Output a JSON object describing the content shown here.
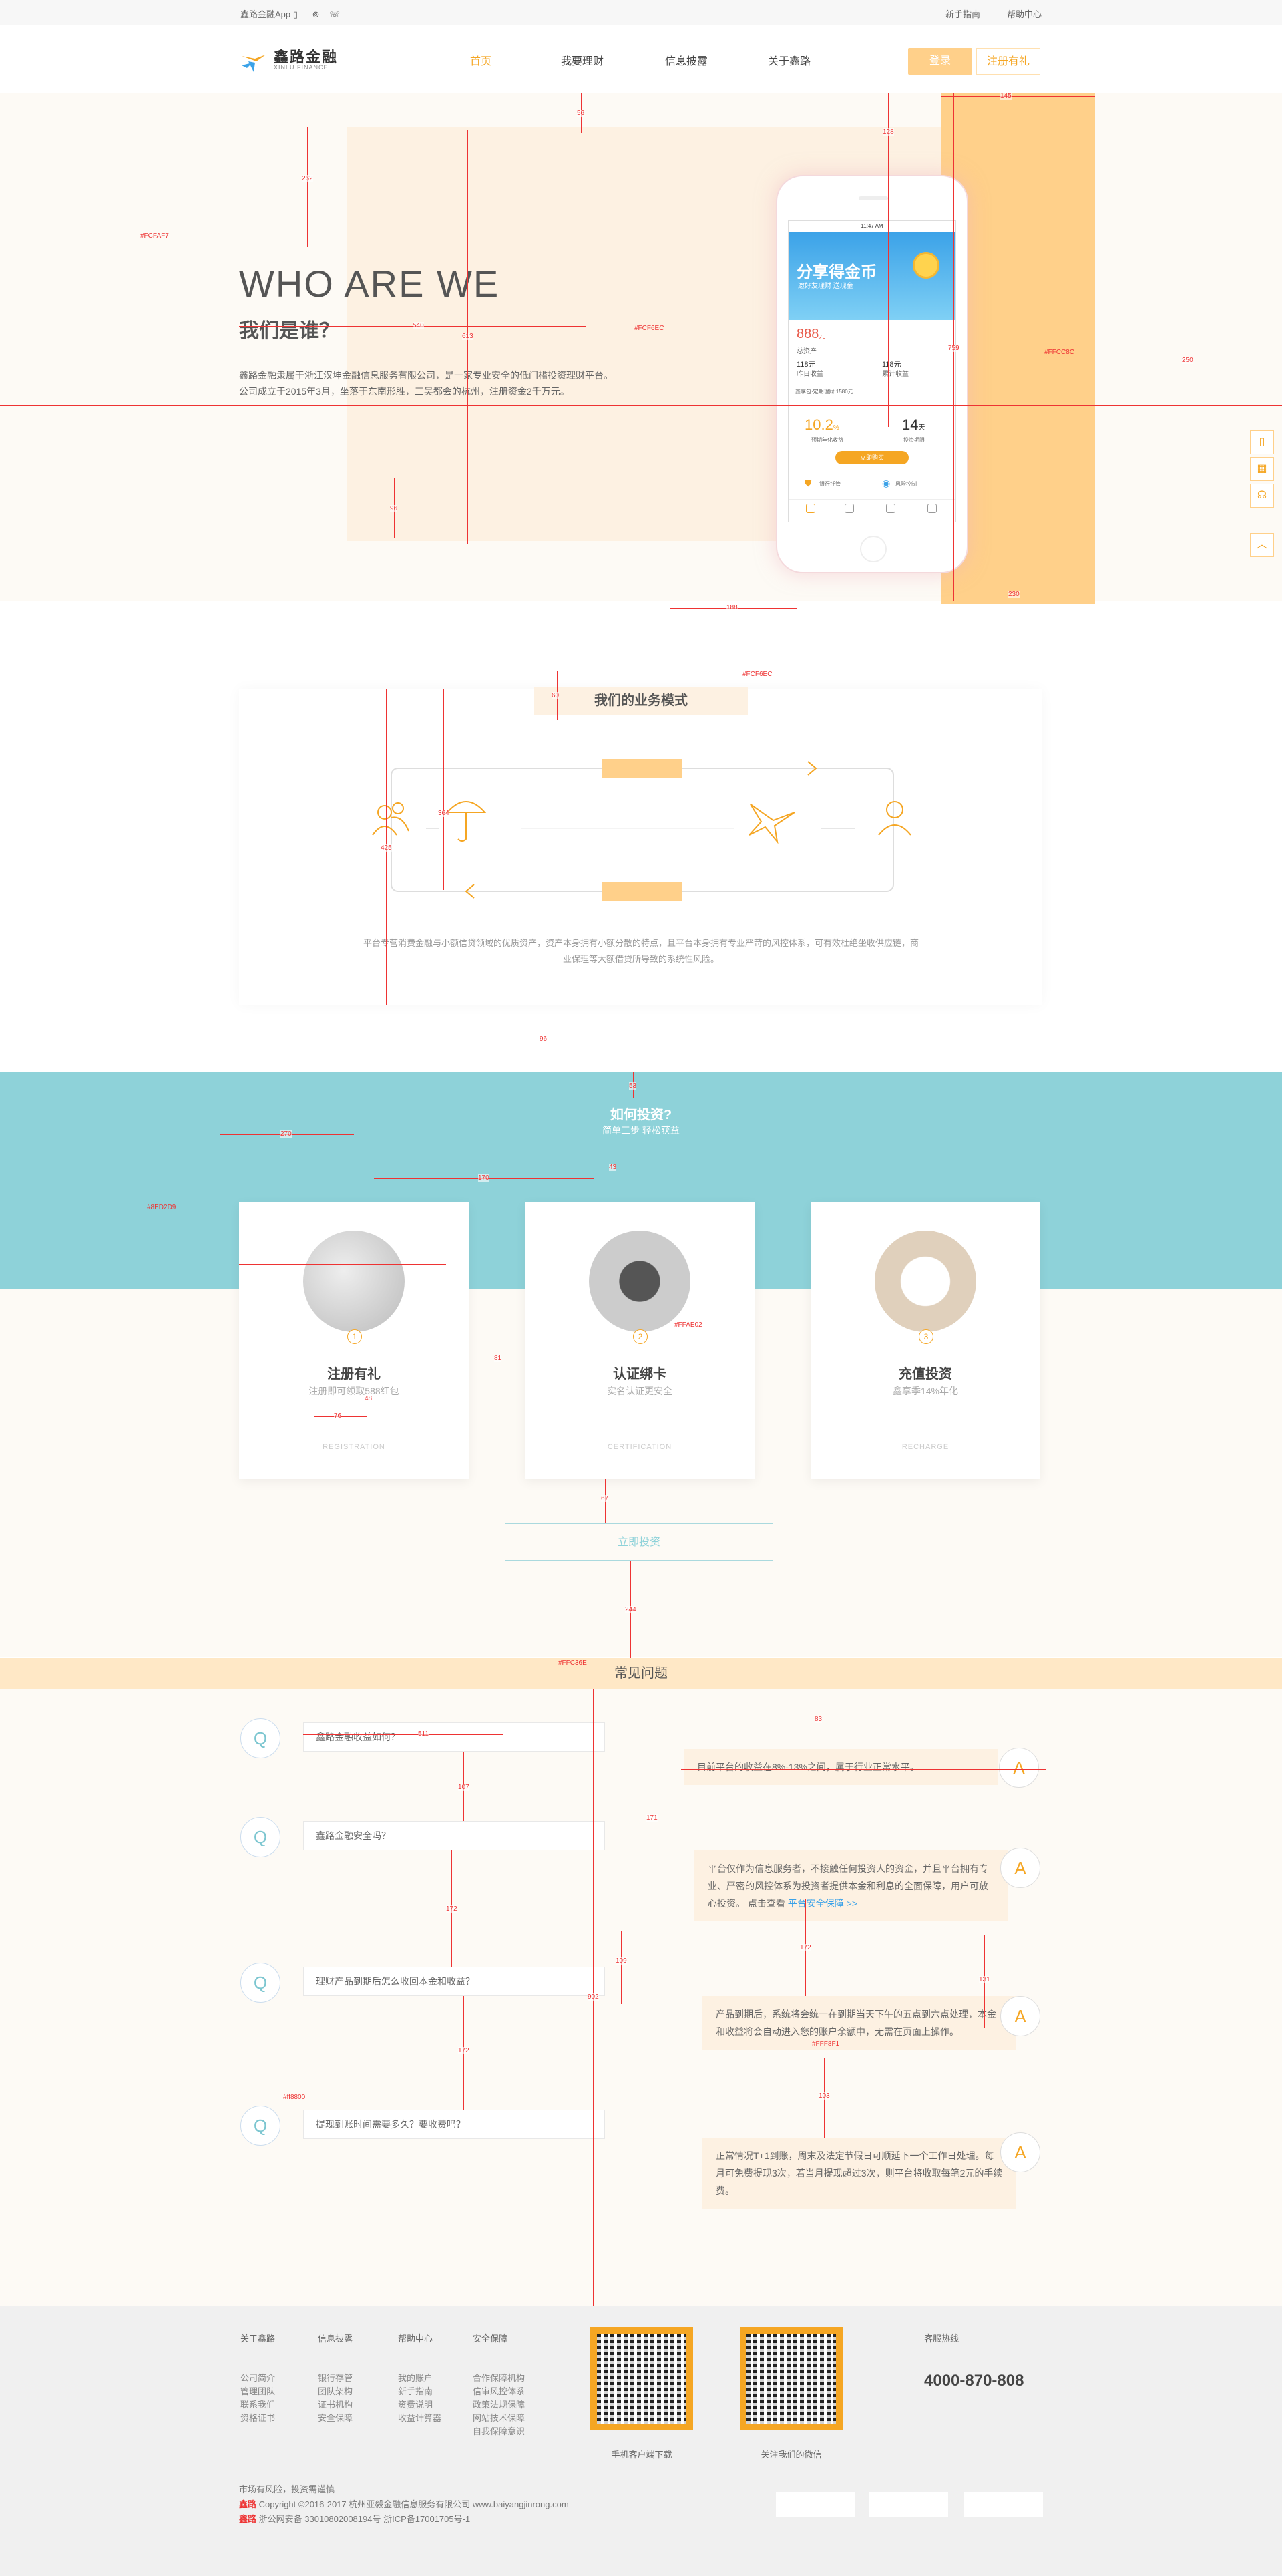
{
  "topbar": {
    "app": "鑫路金融App",
    "help1": "新手指南",
    "help2": "帮助中心"
  },
  "header": {
    "logo_cn": "鑫路金融",
    "logo_en": "XINLU FINANCE",
    "nav": [
      "首页",
      "我要理财",
      "信息披露",
      "关于鑫路"
    ],
    "login": "登录",
    "register": "注册有礼"
  },
  "hero": {
    "title_en": "WHO ARE WE",
    "title_cn": "我们是谁？",
    "desc": "鑫路金融隶属于浙江汉坤金融信息服务有限公司，是一家专业安全的低门槛投资理财平台。公司成立于2015年3月，坐落于东南形胜，三吴都会的杭州，注册资金2千万元。"
  },
  "phone": {
    "status": "11:47 AM",
    "banner_title": "分享得金币",
    "banner_sub": "邀好友理财 送现金",
    "amount": "888",
    "amount_unit": "元",
    "amount_label": "总资产",
    "s1": "118元",
    "s1l": "昨日收益",
    "s2": "118元",
    "s2l": "累计收益",
    "notice": "鑫享包·定期理财 1580元",
    "rate": "10.2",
    "rate_unit": "%",
    "rate_label": "预期年化收益",
    "days": "14",
    "days_unit": "天",
    "days_label": "投资期限",
    "buy_btn": "立即购买",
    "feat1": "银行托管",
    "feat2": "风险控制"
  },
  "business": {
    "title": "我们的业务模式",
    "desc": "平台专营消费金融与小额信贷领域的优质资产，资产本身拥有小额分散的特点，且平台本身拥有专业严苛的风控体系，可有效杜绝坐收供应链，商业保理等大额借贷所导致的系统性风险。"
  },
  "invest": {
    "title": "如何投资?",
    "subtitle": "简单三步  轻松获益",
    "cards": [
      {
        "step": "1",
        "title": "注册有礼",
        "sub": "注册即可领取588红包",
        "en": "REGISTRATION"
      },
      {
        "step": "2",
        "title": "认证绑卡",
        "sub": "实名认证更安全",
        "en": "CERTIFICATION"
      },
      {
        "step": "3",
        "title": "充值投资",
        "sub": "鑫享季14%年化",
        "en": "RECHARGE"
      }
    ],
    "enter_btn": "立即投资"
  },
  "faq": {
    "title": "常见问题",
    "q_badge": "Q",
    "a_badge": "A",
    "items": [
      {
        "q": "鑫路金融收益如何？",
        "a": "目前平台的收益在8%-13%之间，属于行业正常水平。"
      },
      {
        "q": "鑫路金融安全吗？",
        "a": "平台仅作为信息服务者，不接触任何投资人的资金，并且平台拥有专业、严密的风控体系为投资者提供本金和利息的全面保障，用户可放心投资。",
        "link": "平台安全保障 >>",
        "link_prefix": "点击查看"
      },
      {
        "q": "理财产品到期后怎么收回本金和收益？",
        "a": "产品到期后，系统将会统一在到期当天下午的五点到六点处理，本金和收益将会自动进入您的账户余额中，无需在页面上操作。"
      },
      {
        "q": "提现到账时间需要多久？要收费吗？",
        "a": "正常情况T+1到账，周末及法定节假日可顺延下一个工作日处理。每月可免费提现3次，若当月提现超过3次，则平台将收取每笔2元的手续费。"
      }
    ]
  },
  "footer": {
    "cols": [
      {
        "title": "关于鑫路",
        "items": [
          "公司简介",
          "管理团队",
          "联系我们",
          "资格证书"
        ]
      },
      {
        "title": "信息披露",
        "items": [
          "银行存管",
          "团队架构",
          "证书机构",
          "安全保障"
        ]
      },
      {
        "title": "帮助中心",
        "items": [
          "我的账户",
          "新手指南",
          "资费说明",
          "收益计算器"
        ]
      },
      {
        "title": "安全保障",
        "items": [
          "合作保障机构",
          "信审风控体系",
          "政策法规保障",
          "网站技术保障",
          "自我保障意识"
        ]
      }
    ],
    "qr1": "手机客户端下载",
    "qr2": "关注我们的微信",
    "service": "客服热线",
    "tel": "4000-870-808",
    "risk": "市场有风险，投资需谨慎",
    "copy_label": "鑫路",
    "copy": "Copyright ©2016-2017 杭州亚毅金融信息服务有限公司 www.baiyangjinrong.com",
    "icp_label": "鑫路",
    "icp": "浙公网安备 33010802008194号 浙ICP备17001705号-1"
  },
  "annotations": {
    "c1": "#FCFAF7",
    "c2": "#FCF6EC",
    "c3": "#FFCC8C",
    "c4": "#FCF6EC",
    "c5": "#8ED2D9",
    "c6": "#FFAE02",
    "c7": "#FFC36E",
    "c8": "#FFF8F1",
    "c9": "#ff8800",
    "n": [
      "262",
      "56",
      "128",
      "145",
      "540",
      "613",
      "759",
      "250",
      "96",
      "188",
      "230",
      "60",
      "425",
      "364",
      "96",
      "53",
      "270",
      "170",
      "43",
      "48",
      "81",
      "76",
      "67",
      "244",
      "511",
      "101",
      "83",
      "46",
      "107",
      "171",
      "172",
      "109",
      "902",
      "172",
      "98",
      "131",
      "172",
      "103",
      "40"
    ]
  },
  "colors": {
    "accent": "#f5a623",
    "teal": "#8ed2d9",
    "cream": "#fdf1e2",
    "orange_light": "#ffd08a"
  }
}
